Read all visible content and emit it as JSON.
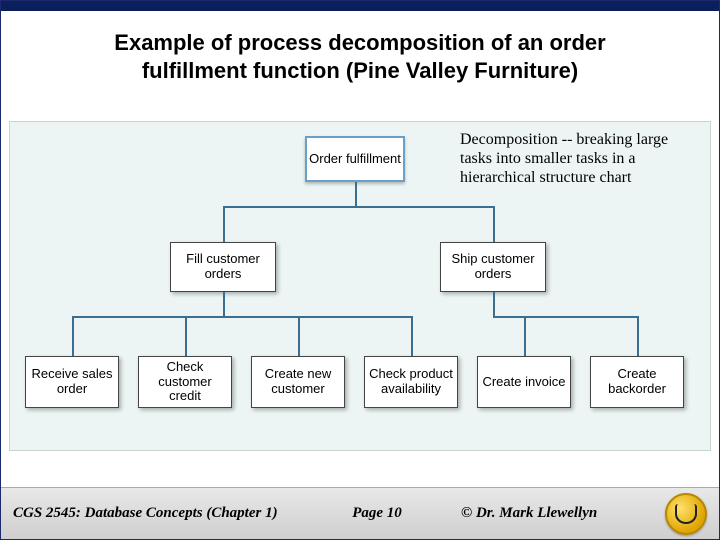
{
  "title_line1": "Example of process decomposition of an order",
  "title_line2": "fulfillment function (Pine Valley Furniture)",
  "annotation": "Decomposition -- breaking large tasks into smaller tasks in a hierarchical structure chart",
  "chart_data": {
    "type": "tree",
    "root": "Order fulfillment",
    "mid": [
      "Fill customer orders",
      "Ship customer orders"
    ],
    "leaves": [
      "Receive sales order",
      "Check customer credit",
      "Create new customer",
      "Check product availability",
      "Create invoice",
      "Create backorder"
    ]
  },
  "footer": {
    "course": "CGS 2545: Database Concepts  (Chapter 1)",
    "page": "Page 10",
    "copyright": "© Dr. Mark Llewellyn"
  }
}
